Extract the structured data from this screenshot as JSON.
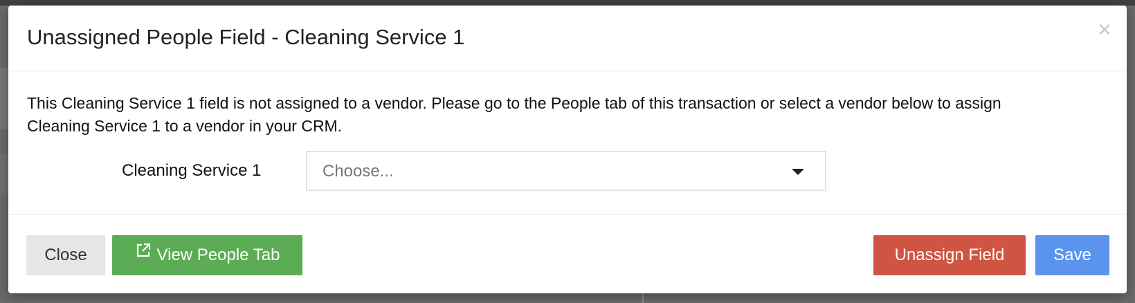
{
  "modal": {
    "title": "Unassigned People Field - Cleaning Service 1",
    "close_symbol": "×",
    "message": "This Cleaning Service 1 field is not assigned to a vendor. Please go to the People tab of this transaction or select a vendor below to assign Cleaning Service 1 to a vendor in your CRM.",
    "field": {
      "label": "Cleaning Service 1",
      "select_value": "Choose..."
    },
    "footer": {
      "close_label": "Close",
      "view_people_label": "View People Tab",
      "view_people_icon": "external-link-icon",
      "unassign_label": "Unassign Field",
      "save_label": "Save"
    }
  },
  "colors": {
    "green": "#5cab55",
    "red": "#cf5542",
    "blue": "#5b94ef",
    "grey": "#e6e6e6"
  }
}
